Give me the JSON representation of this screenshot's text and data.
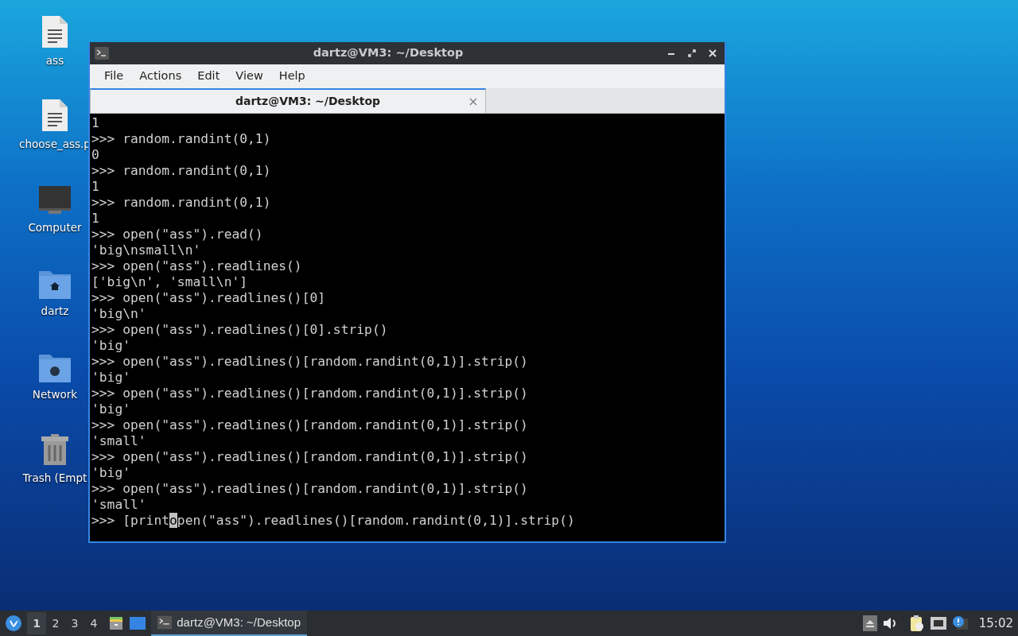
{
  "desktop_icons": [
    {
      "label": "ass",
      "kind": "document"
    },
    {
      "label": "choose_ass.p",
      "kind": "document"
    },
    {
      "label": "Computer",
      "kind": "computer"
    },
    {
      "label": "dartz",
      "kind": "home"
    },
    {
      "label": "Network",
      "kind": "network"
    },
    {
      "label": "Trash (Empt",
      "kind": "trash"
    }
  ],
  "window": {
    "title": "dartz@VM3: ~/Desktop",
    "menu": [
      "File",
      "Actions",
      "Edit",
      "View",
      "Help"
    ],
    "tabs": [
      {
        "label": "dartz@VM3: ~/Desktop",
        "selected": true
      }
    ],
    "terminal": {
      "lines": [
        "1",
        ">>> random.randint(0,1)",
        "0",
        ">>> random.randint(0,1)",
        "1",
        ">>> random.randint(0,1)",
        "1",
        ">>> open(\"ass\").read()",
        "'big\\nsmall\\n'",
        ">>> open(\"ass\").readlines()",
        "['big\\n', 'small\\n']",
        ">>> open(\"ass\").readlines()[0]",
        "'big\\n'",
        ">>> open(\"ass\").readlines()[0].strip()",
        "'big'",
        ">>> open(\"ass\").readlines()[random.randint(0,1)].strip()",
        "'big'",
        ">>> open(\"ass\").readlines()[random.randint(0,1)].strip()",
        "'big'",
        ">>> open(\"ass\").readlines()[random.randint(0,1)].strip()",
        "'small'",
        ">>> open(\"ass\").readlines()[random.randint(0,1)].strip()",
        "'big'",
        ">>> open(\"ass\").readlines()[random.randint(0,1)].strip()",
        "'small'"
      ],
      "input_line": {
        "before_cursor": ">>> [print",
        "at_cursor": "o",
        "after_cursor": "pen(\"ass\").readlines()[random.randint(0,1)].strip()"
      }
    }
  },
  "taskbar": {
    "workspaces": [
      {
        "label": "1",
        "selected": true
      },
      {
        "label": "2",
        "selected": false
      },
      {
        "label": "3",
        "selected": false
      },
      {
        "label": "4",
        "selected": false
      }
    ],
    "tasks": [
      {
        "label": "dartz@VM3: ~/Desktop",
        "selected": true
      }
    ],
    "clock": "15:02"
  }
}
